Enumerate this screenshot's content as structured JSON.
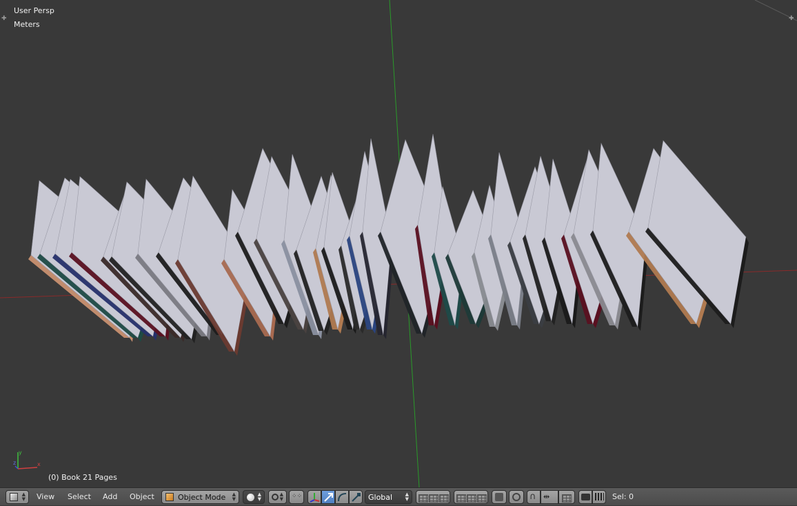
{
  "viewport": {
    "view_name": "User Persp",
    "units": "Meters",
    "active_object": "(0) Book 21 Pages"
  },
  "header": {
    "menus": [
      "View",
      "Select",
      "Add",
      "Object"
    ],
    "mode": "Object Mode",
    "orientation": "Global",
    "sel_label": "Sel: 0"
  },
  "colors": {
    "background": "#393939",
    "x_axis": "#8a2a2a",
    "y_axis": "#2a9a2a",
    "accent_blue": "#5680c2"
  },
  "icons": {
    "editor_type": "cube-icon",
    "mode": "orange-cube-icon",
    "shading": "sphere-icon",
    "pivot": "pivot-icon",
    "manipulator": "axis-widget-icon",
    "snap": "magnet-icon",
    "render": "camera-icon"
  }
}
